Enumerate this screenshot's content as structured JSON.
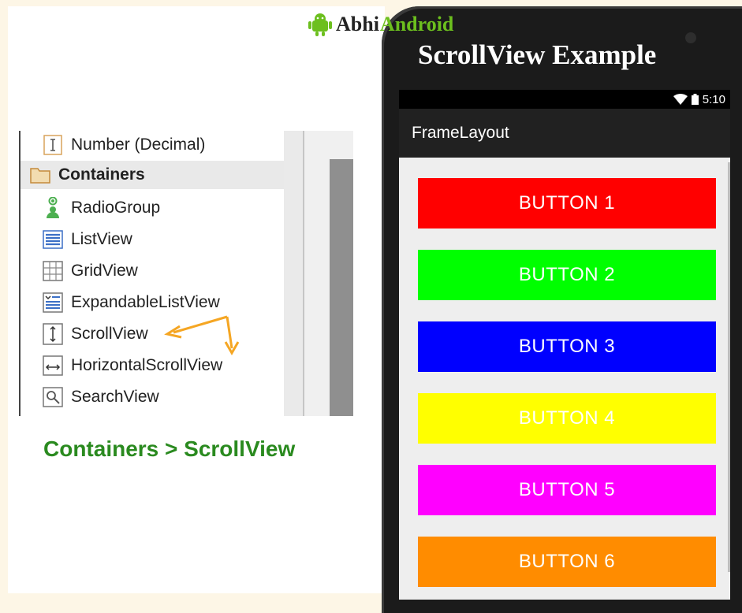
{
  "logo": {
    "abhi": "Abhi",
    "android": "Android"
  },
  "phone_title": "ScrollView Example",
  "status_bar": {
    "time": "5:10"
  },
  "action_bar": {
    "title": "FrameLayout"
  },
  "palette": {
    "items": [
      {
        "label": "Number (Decimal)",
        "icon": "text-cursor-icon"
      },
      {
        "label": "Containers",
        "icon": "folder-icon",
        "header": true
      },
      {
        "label": "RadioGroup",
        "icon": "radio-group-icon"
      },
      {
        "label": "ListView",
        "icon": "list-icon"
      },
      {
        "label": "GridView",
        "icon": "grid-icon"
      },
      {
        "label": "ExpandableListView",
        "icon": "expandable-list-icon"
      },
      {
        "label": "ScrollView",
        "icon": "vertical-arrows-icon"
      },
      {
        "label": "HorizontalScrollView",
        "icon": "horizontal-arrows-icon"
      },
      {
        "label": "SearchView",
        "icon": "magnifier-icon"
      }
    ]
  },
  "caption": "Containers > ScrollView",
  "buttons": [
    {
      "label": "BUTTON 1",
      "color": "#ff0000"
    },
    {
      "label": "BUTTON 2",
      "color": "#00ff00"
    },
    {
      "label": "BUTTON 3",
      "color": "#0000ff"
    },
    {
      "label": "BUTTON 4",
      "color": "#ffff00"
    },
    {
      "label": "BUTTON 5",
      "color": "#ff00ff"
    },
    {
      "label": "BUTTON 6",
      "color": "#ff8c00"
    }
  ],
  "colors": {
    "accent_green": "#2a8a1f",
    "arrow": "#f5a623",
    "logo_green": "#6cbf1e"
  }
}
